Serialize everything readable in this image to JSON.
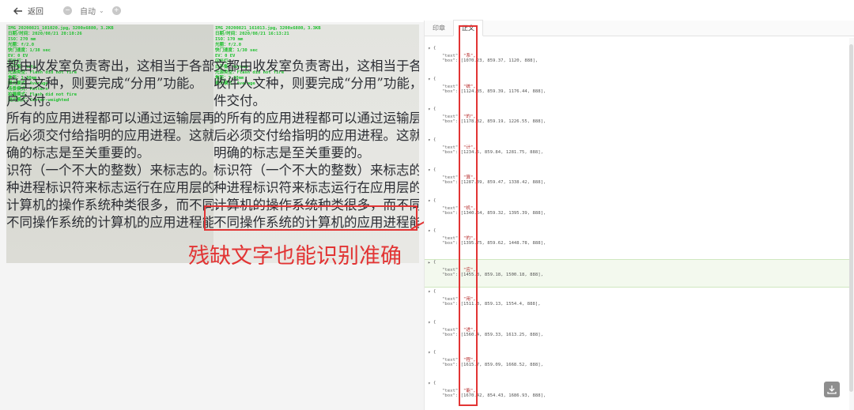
{
  "toolbar": {
    "back_label": "返回",
    "zoom_out_symbol": "−",
    "zoom_mode": "自动",
    "zoom_in_symbol": "+"
  },
  "photo": {
    "meta_left": [
      "IMG_20200821_101020.jpg，3200x6880，3.2KB",
      "日期/时间：2020/08/21 20:10:26",
      "ISO：270 mm",
      "光圈：f/2.0",
      "快门速度：1/38 sec",
      "EV：0 EV",
      "闪光灯：",
      "白平衡：Auto",
      "光源类型：Flash did not fire",
      "焦距：3.80mm",
      "曝光模式：Average",
      "场景模式：Pattern",
      "拍摄模式：Flash did not fire",
      "测光模式：Center-weighted"
    ],
    "meta_right": [
      "IMG_20200821_161013.jpg，3200x6880，3.3KB",
      "日期/时间：2020/08/21 16:13:21",
      "ISO：170 mm",
      "光圈：f/2.0",
      "快门速度：1/30 sec",
      "EV：0 EV",
      "闪光灯：",
      "白平衡：Normal",
      "光源类型：Flash did not fire",
      "焦距：3.80mm",
      "曝光模式：Average"
    ],
    "lines_left": [
      "都由收发室负责寄出，这相当于各部",
      "户主文种，则要完成“分用”功能。",
      "户交付。",
      "所有的应用进程都可以通过运输层再传送",
      "后必须交付给指明的应用进程。这就是说",
      "确的标志是至关重要的。",
      "识符（一个不大的整数）来标志的。但",
      "种进程标识符来标志运行在应用层的各种",
      "计算机的操作系统种类很多，而不同的",
      "不同操作系统的计算机的应用进程能够"
    ],
    "lines_right": [
      "文都由收发室负责寄出，这相当于各部门",
      "收件人文种，则要完成“分用”功能，即",
      "件交付。",
      "的所有的应用进程都可以通过运输层再传",
      "后必须交付给指明的应用进程。这就",
      "明确的标志是至关重要的。",
      "标识符（一个不大的整数）来标志的。",
      "种进程标识符来标志运行在应用层的",
      "计算机的操作系统种类很多，而不同的",
      "不同操作系统的计算机的应用进程能"
    ]
  },
  "caption": "残缺文字也能识别准确",
  "tabs": [
    "印章",
    "正文"
  ],
  "json_items": [
    {
      "toggle": "▾",
      "text": "\"系\"",
      "box": "[1070.23,  859.37,  1120,  888],"
    },
    {
      "toggle": "▾",
      "text": "\"统\"",
      "box": "[1124.85,  859.39,  1176.44,  888],"
    },
    {
      "toggle": "▾",
      "text": "\"的\"",
      "box": "[1178.82,  859.19,  1226.55,  888],"
    },
    {
      "toggle": "▾",
      "text": "\"计\"",
      "box": "[1234.5,  859.84,  1281.75,  888],"
    },
    {
      "toggle": "▾",
      "text": "\"算\"",
      "box": "[1287.39,  859.47,  1338.42,  888],"
    },
    {
      "toggle": "▾",
      "text": "\"机\"",
      "box": "[1340.64,  859.32,  1395.39,  888],"
    },
    {
      "toggle": "▾",
      "text": "\"的\"",
      "box": "[1395.75,  859.62,  1448.78,  888],"
    },
    {
      "toggle": "▸",
      "text": "\"应\"",
      "box": "[1455.8,  859.18,  1500.18,  888],"
    },
    {
      "toggle": "▾",
      "text": "\"用\"",
      "box": "[1511.3,  859.13,  1554.4,  888],"
    },
    {
      "toggle": "▾",
      "text": "\"进\"",
      "box": "[1560.4,  859.33,  1613.25,  888],"
    },
    {
      "toggle": "▾",
      "text": "\"程\"",
      "box": "[1615.7,  859.09,  1668.52,  888],"
    },
    {
      "toggle": "▾",
      "text": "\"能\"",
      "box": "[1670.42,  854.43,  1686.93,  888],"
    }
  ],
  "json_keys": {
    "text": "\"text\":",
    "box": "\"box\":"
  },
  "colors": {
    "accent_red": "#e23434",
    "ocr_green": "#1fbf2f",
    "selected_row": "#f3f9ee"
  },
  "icons": {
    "back": "arrow-left-icon",
    "download": "download-icon"
  }
}
